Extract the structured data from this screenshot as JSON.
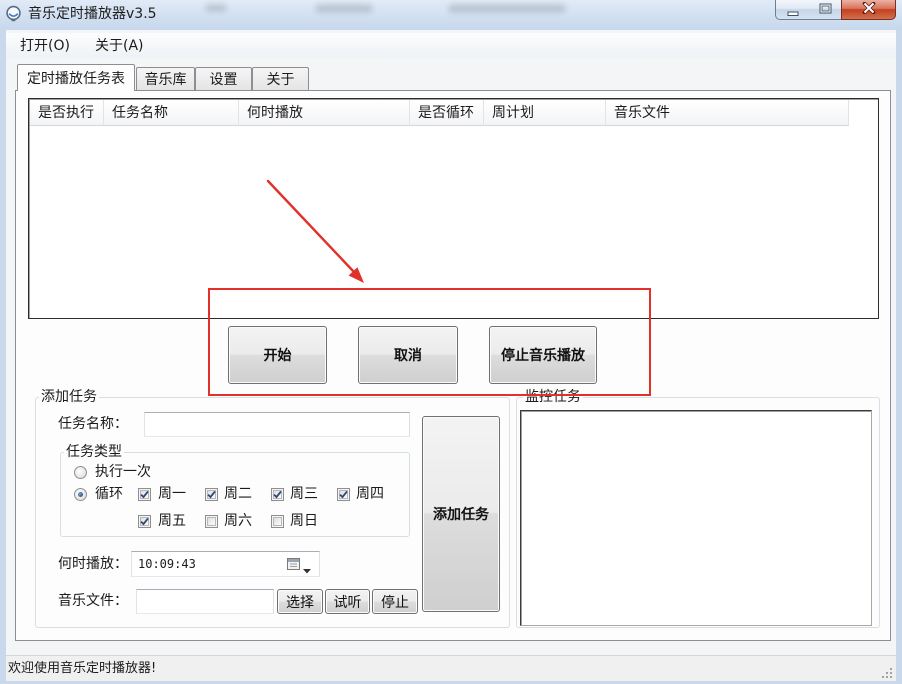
{
  "window": {
    "title": "音乐定时播放器v3.5"
  },
  "icons": {
    "app": "app-icon",
    "minimize": "minimize-icon",
    "maximize": "maximize-icon",
    "close": "close-icon",
    "calendar": "calendar-icon",
    "dropdown": "chevron-down-icon",
    "resize": "resize-grip-icon"
  },
  "menu": {
    "items": [
      {
        "label": "打开(O)"
      },
      {
        "label": "关于(A)"
      }
    ]
  },
  "tabs": [
    {
      "label": "定时播放任务表",
      "active": true
    },
    {
      "label": "音乐库",
      "active": false
    },
    {
      "label": "设置",
      "active": false
    },
    {
      "label": "关于",
      "active": false
    }
  ],
  "task_list": {
    "columns": [
      "是否执行",
      "任务名称",
      "何时播放",
      "是否循环",
      "周计划",
      "音乐文件"
    ],
    "rows": []
  },
  "actions": {
    "start_label": "开始",
    "cancel_label": "取消",
    "stop_music_label": "停止音乐播放"
  },
  "add_task": {
    "title": "添加任务",
    "task_name_label": "任务名称：",
    "task_name_value": "",
    "task_type": {
      "title": "任务类型",
      "once_label": "执行一次",
      "loop_label": "循环",
      "selected": "loop",
      "days": [
        {
          "label": "周一",
          "checked": true
        },
        {
          "label": "周二",
          "checked": true
        },
        {
          "label": "周三",
          "checked": true
        },
        {
          "label": "周四",
          "checked": true
        },
        {
          "label": "周五",
          "checked": true
        },
        {
          "label": "周六",
          "checked": false
        },
        {
          "label": "周日",
          "checked": false
        }
      ]
    },
    "play_time_label": "何时播放：",
    "play_time_value": "10:09:43",
    "music_file_label": "音乐文件：",
    "music_file_value": "",
    "choose_label": "选择",
    "preview_label": "试听",
    "stop_label": "停止",
    "submit_label": "添加任务"
  },
  "monitor": {
    "title": "监控任务",
    "log": ""
  },
  "status_bar": {
    "text": "欢迎使用音乐定时播放器!"
  },
  "colors": {
    "annotation": "#e2302b"
  }
}
